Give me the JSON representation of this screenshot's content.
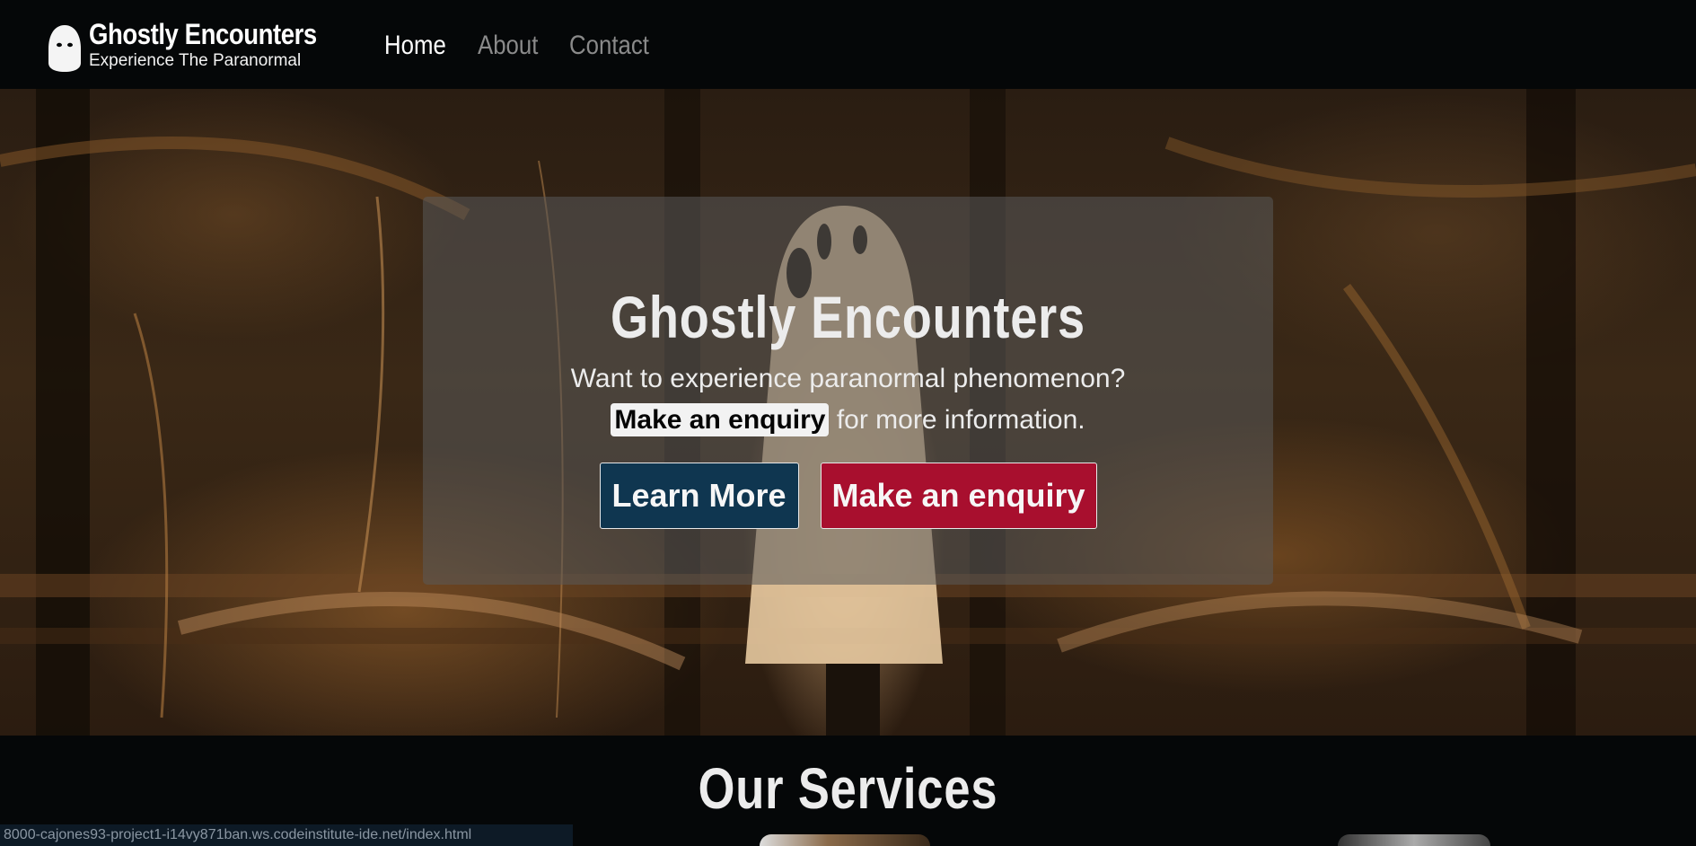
{
  "nav": {
    "brand_title": "Ghostly Encounters",
    "brand_tagline": "Experience The Paranormal",
    "logo_icon": "ghost-icon",
    "links": [
      {
        "label": "Home",
        "active": true
      },
      {
        "label": "About",
        "active": false
      },
      {
        "label": "Contact",
        "active": false
      }
    ]
  },
  "hero": {
    "title": "Ghostly Encounters",
    "question": "Want to experience paranormal phenomenon?",
    "enquiry_link": "Make an enquiry",
    "enquiry_suffix": " for more information.",
    "learn_more_label": "Learn More",
    "enquiry_button_label": "Make an enquiry"
  },
  "services": {
    "heading": "Our Services"
  },
  "status_bar": {
    "url": "8000-cajones93-project1-i14vy871ban.ws.codeinstitute-ide.net/index.html"
  },
  "colors": {
    "background": "#050708",
    "learn_more_button": "#0f3650",
    "enquiry_button": "#a80f2e",
    "nav_inactive": "#8a8a8a",
    "nav_active": "#ffffff"
  }
}
